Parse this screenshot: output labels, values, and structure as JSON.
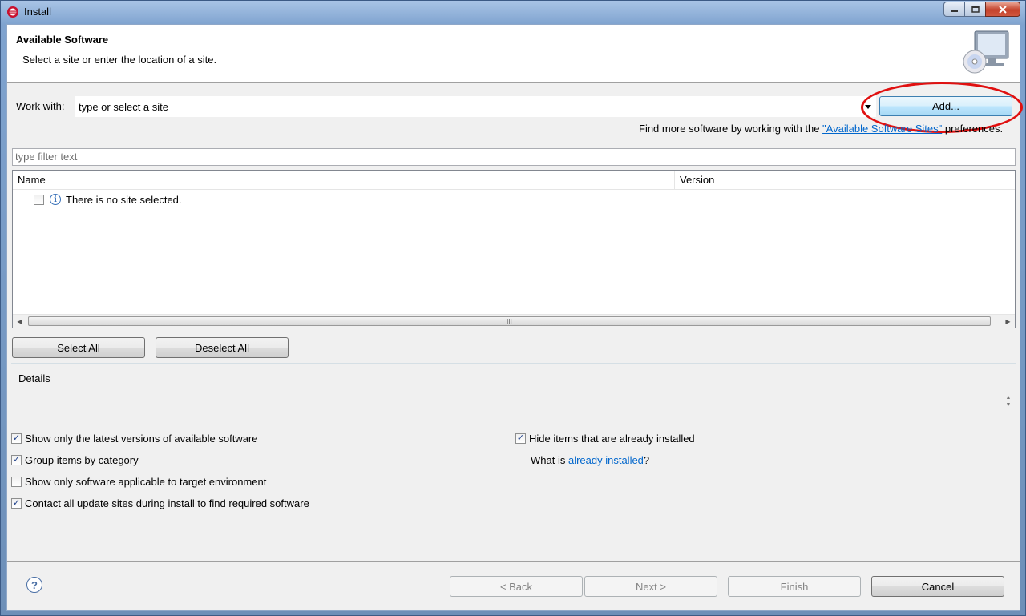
{
  "window": {
    "title": "Install",
    "controls": [
      "minimize-icon",
      "maximize-icon",
      "close-icon"
    ]
  },
  "banner": {
    "title": "Available Software",
    "subtitle": "Select a site or enter the location of a site.",
    "image_icon": "computer-cd-icon"
  },
  "work_with": {
    "label": "Work with:",
    "value": "type or select a site",
    "add_button": "Add...",
    "more_prefix": "Find more software by working with the ",
    "more_link": "\"Available Software Sites\"",
    "more_suffix": " preferences."
  },
  "filter": {
    "placeholder": "type filter text"
  },
  "table": {
    "columns": [
      "Name",
      "Version"
    ],
    "rows": [
      {
        "checked": false,
        "icon": "info-icon",
        "name": "There is no site selected.",
        "version": ""
      }
    ],
    "scroll_grip": "III"
  },
  "selection_buttons": {
    "select_all": "Select All",
    "deselect_all": "Deselect All"
  },
  "details": {
    "label": "Details"
  },
  "options": {
    "latest_versions": {
      "label": "Show only the latest versions of available software",
      "checked": true
    },
    "group_by_category": {
      "label": "Group items by category",
      "checked": true
    },
    "target_env": {
      "label": "Show only software applicable to target environment",
      "checked": false
    },
    "contact_sites": {
      "label": "Contact all update sites during install to find required software",
      "checked": true
    },
    "hide_installed": {
      "label": "Hide items that are already installed",
      "checked": true
    },
    "what_is_prefix": "What is ",
    "what_is_link": "already installed",
    "what_is_suffix": "?"
  },
  "footer": {
    "help": "?",
    "back": "< Back",
    "next": "Next >",
    "finish": "Finish",
    "cancel": "Cancel"
  },
  "colors": {
    "link": "#0066cc",
    "highlight_ellipse": "#e01010",
    "title_gradient": "#7fa3cf"
  }
}
